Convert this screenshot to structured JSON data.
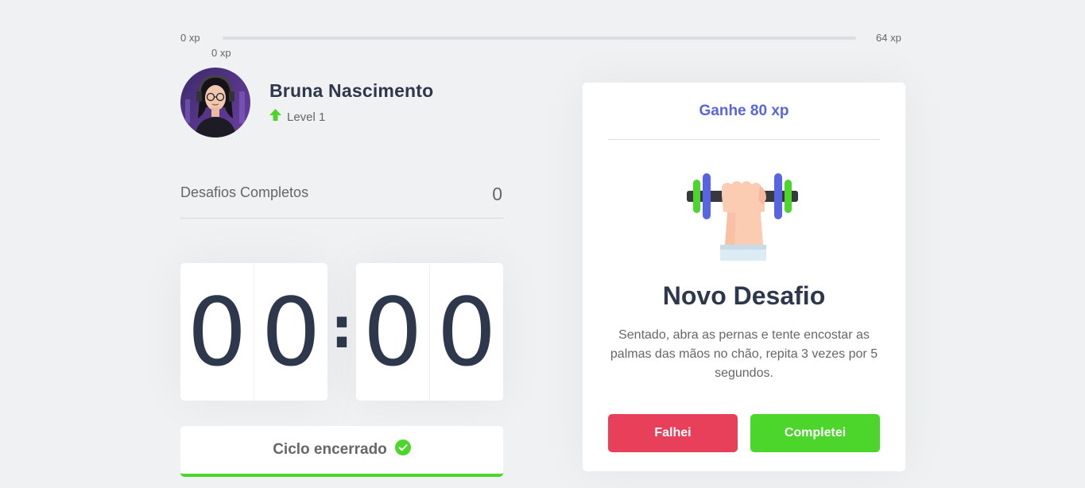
{
  "xp_bar": {
    "start_label": "0 xp",
    "end_label": "64 xp",
    "current_label": "0 xp",
    "progress_percent": 0
  },
  "profile": {
    "name": "Bruna Nascimento",
    "level_label": "Level 1",
    "level_icon": "level-up-arrow-icon"
  },
  "completed_challenges": {
    "label": "Desafios Completos",
    "value": "0"
  },
  "countdown": {
    "minute_left": "0",
    "minute_right": "0",
    "separator": ":",
    "second_left": "0",
    "second_right": "0"
  },
  "cycle_button": {
    "label": "Ciclo encerrado",
    "icon": "check-circle-icon"
  },
  "challenge": {
    "reward": "Ganhe 80 xp",
    "icon": "dumbbell-icon",
    "title": "Novo Desafio",
    "description": "Sentado, abra as pernas e tente encostar as palmas das mãos no chão, repita 3 vezes por 5 segundos.",
    "fail_label": "Falhei",
    "success_label": "Completei"
  },
  "colors": {
    "background": "#f0f1f3",
    "title": "#2e384d",
    "text": "#666666",
    "blue": "#5965e0",
    "green": "#4cd62b",
    "red": "#e83f5b"
  }
}
